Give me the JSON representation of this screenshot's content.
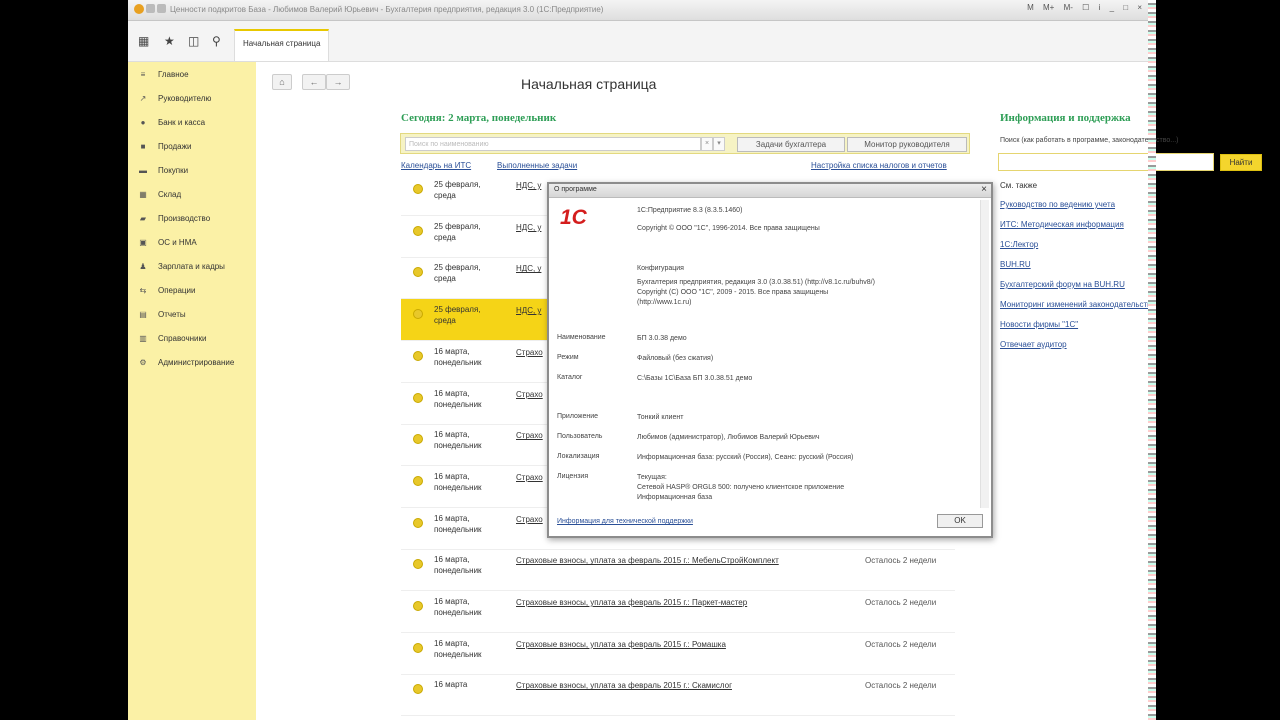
{
  "window": {
    "title": "Ценности подкритов База - Любимов Валерий Юрьевич - Бухгалтерия предприятия, редакция 3.0 (1С:Предприятие)",
    "right_items": [
      "M",
      "M+",
      "M-",
      "☐",
      "i",
      "_",
      "□",
      "×"
    ]
  },
  "toolbar": {
    "home_tab": "Начальная страница",
    "icons": [
      "grid-icon",
      "star-icon",
      "history-icon",
      "search-icon"
    ]
  },
  "sidebar": {
    "items": [
      {
        "icon": "≡",
        "label": "Главное"
      },
      {
        "icon": "↗",
        "label": "Руководителю"
      },
      {
        "icon": "●",
        "label": "Банк и касса"
      },
      {
        "icon": "■",
        "label": "Продажи"
      },
      {
        "icon": "▬",
        "label": "Покупки"
      },
      {
        "icon": "▦",
        "label": "Склад"
      },
      {
        "icon": "▰",
        "label": "Производство"
      },
      {
        "icon": "▣",
        "label": "ОС и НМА"
      },
      {
        "icon": "♟",
        "label": "Зарплата и кадры"
      },
      {
        "icon": "⇆",
        "label": "Операции"
      },
      {
        "icon": "▤",
        "label": "Отчеты"
      },
      {
        "icon": "▥",
        "label": "Справочники"
      },
      {
        "icon": "⚙",
        "label": "Администрирование"
      }
    ]
  },
  "main": {
    "page_title": "Начальная страница",
    "today": "Сегодня: 2 марта, понедельник",
    "search_placeholder": "Поиск по наименованию",
    "tab_tasks": "Задачи бухгалтера",
    "tab_monitor": "Монитор руководителя",
    "link_calendar": "Календарь на ИТС",
    "link_done": "Выполненные задачи",
    "link_settings": "Настройка списка налогов и отчетов",
    "tasks": [
      {
        "date": "25 февраля,\nсреда",
        "task": "НДС, у",
        "left": "",
        "highlight": false
      },
      {
        "date": "25 февраля,\nсреда",
        "task": "НДС, у",
        "left": "",
        "highlight": false
      },
      {
        "date": "25 февраля,\nсреда",
        "task": "НДС, у",
        "left": "",
        "highlight": false
      },
      {
        "date": "25 февраля,\nсреда",
        "task": "НДС, у",
        "left": "",
        "highlight": true
      },
      {
        "date": "16 марта,\nпонедельник",
        "task": "Страхо",
        "left": "",
        "highlight": false
      },
      {
        "date": "16 марта,\nпонедельник",
        "task": "Страхо",
        "left": "",
        "highlight": false
      },
      {
        "date": "16 марта,\nпонедельник",
        "task": "Страхо",
        "left": "",
        "highlight": false
      },
      {
        "date": "16 марта,\nпонедельник",
        "task": "Страхо",
        "left": "",
        "highlight": false
      },
      {
        "date": "16 марта,\nпонедельник",
        "task": "Страхо",
        "left": "",
        "highlight": false
      },
      {
        "date": "16 марта,\nпонедельник",
        "task": "Страховые взносы, уплата за февраль 2015 г.: МебельСтройКомплект",
        "left": "Осталось 2 недели",
        "highlight": false
      },
      {
        "date": "16 марта,\nпонедельник",
        "task": "Страховые взносы, уплата за февраль 2015 г.: Паркет-мастер",
        "left": "Осталось 2 недели",
        "highlight": false
      },
      {
        "date": "16 марта,\nпонедельник",
        "task": "Страховые взносы, уплата за февраль 2015 г.: Ромашка",
        "left": "Осталось 2 недели",
        "highlight": false
      },
      {
        "date": "16 марта",
        "task": "Страховые взносы, уплата за февраль 2015 г.: Скамислог",
        "left": "Осталось 2 недели",
        "highlight": false
      }
    ]
  },
  "info": {
    "title": "Информация и поддержка",
    "hint": "Поиск (как работать в программе, законодательство...)",
    "find_button": "Найти",
    "see_also": "См. также",
    "links": [
      "Руководство по ведению учета",
      "ИТС: Методическая информация",
      "1С:Лектор",
      "BUH.RU",
      "Бухгалтерский форум на BUH.RU",
      "Мониторинг изменений законодательства",
      "Новости фирмы \"1С\"",
      "Отвечает аудитор"
    ]
  },
  "about_dialog": {
    "title": "О программе",
    "logo_text": "1С",
    "platform": "1С:Предприятие 8.3 (8.3.5.1460)",
    "copyright": "Copyright © ООО \"1С\", 1996-2014. Все права защищены",
    "config_label": "Конфигурация",
    "config_value": "Бухгалтерия предприятия, редакция 3.0 (3.0.38.51) (http://v8.1c.ru/buhv8/)\nCopyright (C) ООО \"1С\", 2009 - 2015. Все права защищены\n(http://www.1c.ru)",
    "name_label": "Наименование",
    "name_value": "БП 3.0.38 демо",
    "mode_label": "Режим",
    "mode_value": "Файловый (без сжатия)",
    "catalog_label": "Каталог",
    "catalog_value": "C:\\Базы 1С\\База БП 3.0.38.51 демо",
    "app_label": "Приложение",
    "app_value": "Тонкий клиент",
    "user_label": "Пользователь",
    "user_value": "Любимов (администратор), Любимов Валерий Юрьевич",
    "locale_label": "Локализация",
    "locale_value": "Информационная база: русский (Россия), Сеанс: русский (Россия)",
    "license_label": "Лицензия",
    "license_value": "Текущая:\nСетевой HASP® ORGL8 500: получено клиентское приложение\nИнформационная база",
    "support_link": "Информация для технической поддержки",
    "ok_button": "OK"
  },
  "colors": {
    "sidebar_bg": "#fbf1a6",
    "accent_yellow": "#f5d417",
    "heading_green": "#2e9e56",
    "link_blue": "#2a4f97"
  }
}
